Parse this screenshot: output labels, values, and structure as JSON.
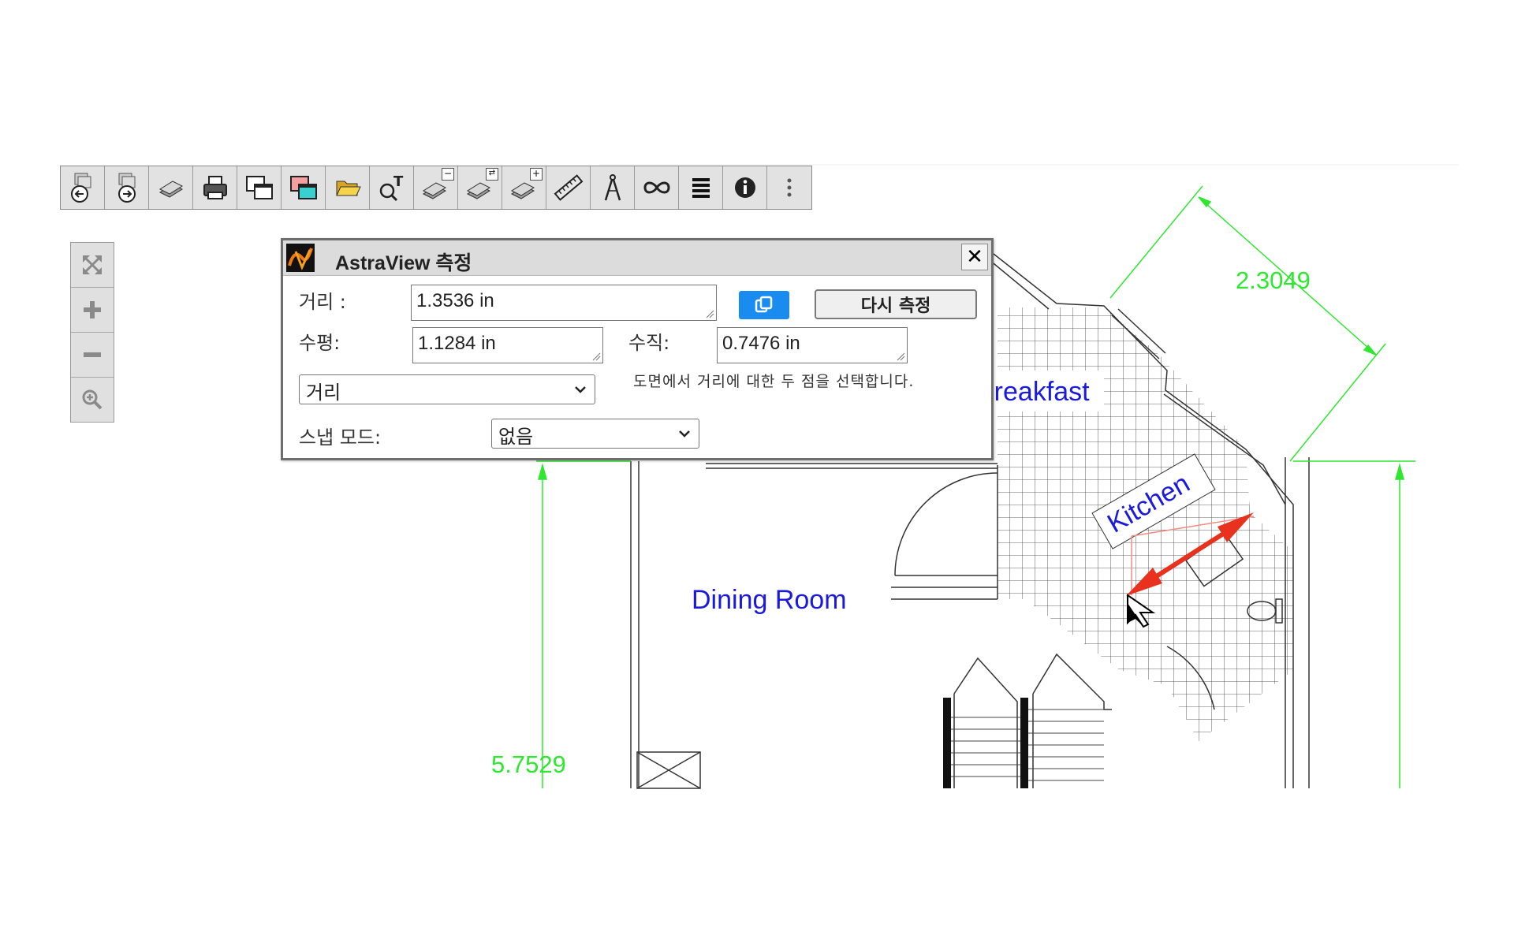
{
  "toolbar": {
    "buttons": [
      {
        "name": "back-view",
        "icon": "pages-back-icon"
      },
      {
        "name": "forward-view",
        "icon": "pages-forward-icon"
      },
      {
        "name": "layers",
        "icon": "layer-stack-icon"
      },
      {
        "name": "print",
        "icon": "printer-icon"
      },
      {
        "name": "compare-windows",
        "icon": "windows-overlay-icon"
      },
      {
        "name": "overlay-color",
        "icon": "windows-color-icon"
      },
      {
        "name": "open-file",
        "icon": "folder-open-icon"
      },
      {
        "name": "text-search",
        "icon": "search-text-icon"
      },
      {
        "name": "remove-layer",
        "icon": "layer-remove-icon",
        "badge": "−"
      },
      {
        "name": "swap-layer",
        "icon": "layer-swap-icon",
        "badge": "⇄"
      },
      {
        "name": "add-layer",
        "icon": "layer-add-icon",
        "badge": "+"
      },
      {
        "name": "measure",
        "icon": "ruler-icon"
      },
      {
        "name": "compass",
        "icon": "compass-icon"
      },
      {
        "name": "link",
        "icon": "infinity-icon"
      },
      {
        "name": "menu",
        "icon": "list-lines-icon"
      },
      {
        "name": "info",
        "icon": "info-icon"
      },
      {
        "name": "more",
        "icon": "vertical-ellipsis-icon"
      }
    ]
  },
  "zoom_panel": {
    "buttons": [
      {
        "name": "fit",
        "icon": "fit-arrows-icon"
      },
      {
        "name": "zoom-in",
        "icon": "plus-icon"
      },
      {
        "name": "zoom-out",
        "icon": "minus-icon"
      },
      {
        "name": "zoom-magnify",
        "icon": "magnifier-plus-icon"
      }
    ]
  },
  "drawing": {
    "rooms": {
      "breakfast": "Breakfast",
      "kitchen": "Kitchen",
      "dining": "Dining Room"
    },
    "dimensions": {
      "diagonal": "2.3049",
      "vertical": "5.7529"
    },
    "colors": {
      "dimension": "#2ee82e",
      "room_text": "#1a1adf",
      "measure_arrow": "#e8321e"
    }
  },
  "dialog": {
    "title": "AstraView 측정",
    "close_label": "✕",
    "distance_label": "거리 :",
    "distance_value": "1.3536 in",
    "horizontal_label": "수평:",
    "horizontal_value": "1.1284 in",
    "vertical_label": "수직:",
    "vertical_value": "0.7476 in",
    "remeasure_label": "다시 측정",
    "mode_value": "거리",
    "hint": "도면에서 거리에 대한 두 점을 선택합니다.",
    "snap_label": "스냅 모드:",
    "snap_value": "없음",
    "accent": "#1a8cf0"
  }
}
